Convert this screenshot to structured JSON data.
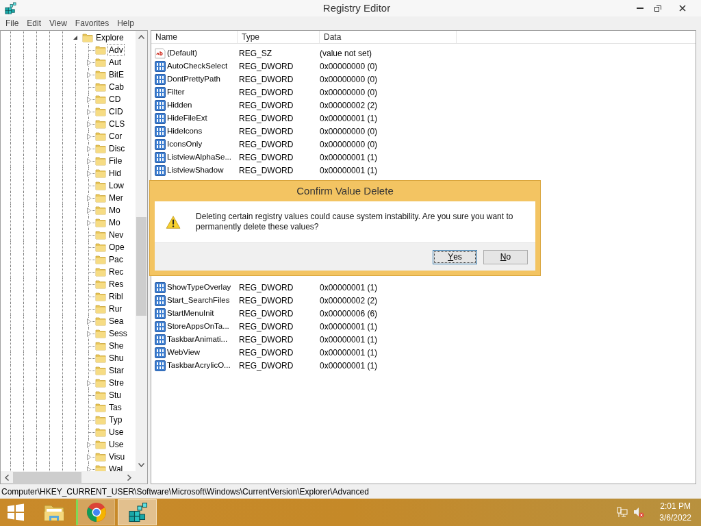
{
  "window": {
    "title": "Registry Editor"
  },
  "menu": [
    "File",
    "Edit",
    "View",
    "Favorites",
    "Help"
  ],
  "tree": [
    {
      "label": "Explore",
      "expanded": true,
      "selected": false,
      "children": [
        {
          "label": "Adv",
          "has_children": false,
          "selected": true
        },
        {
          "label": "Aut",
          "has_children": true,
          "selected": false
        },
        {
          "label": "BitE",
          "has_children": true,
          "selected": false
        },
        {
          "label": "Cab",
          "has_children": false,
          "selected": false
        },
        {
          "label": "CD",
          "has_children": true,
          "selected": false
        },
        {
          "label": "CID",
          "has_children": true,
          "selected": false
        },
        {
          "label": "CLS",
          "has_children": true,
          "selected": false
        },
        {
          "label": "Cor",
          "has_children": true,
          "selected": false
        },
        {
          "label": "Disc",
          "has_children": true,
          "selected": false
        },
        {
          "label": "File",
          "has_children": true,
          "selected": false
        },
        {
          "label": "Hid",
          "has_children": true,
          "selected": false
        },
        {
          "label": "Low",
          "has_children": false,
          "selected": false
        },
        {
          "label": "Mer",
          "has_children": true,
          "selected": false
        },
        {
          "label": "Mo",
          "has_children": true,
          "selected": false
        },
        {
          "label": "Mo",
          "has_children": true,
          "selected": false
        },
        {
          "label": "Nev",
          "has_children": false,
          "selected": false
        },
        {
          "label": "Ope",
          "has_children": false,
          "selected": false
        },
        {
          "label": "Pac",
          "has_children": false,
          "selected": false
        },
        {
          "label": "Rec",
          "has_children": false,
          "selected": false
        },
        {
          "label": "Res",
          "has_children": false,
          "selected": false
        },
        {
          "label": "Ribl",
          "has_children": false,
          "selected": false
        },
        {
          "label": "Rur",
          "has_children": false,
          "selected": false
        },
        {
          "label": "Sea",
          "has_children": true,
          "selected": false
        },
        {
          "label": "Sess",
          "has_children": true,
          "selected": false
        },
        {
          "label": "She",
          "has_children": false,
          "selected": false
        },
        {
          "label": "Shu",
          "has_children": false,
          "selected": false
        },
        {
          "label": "Star",
          "has_children": false,
          "selected": false
        },
        {
          "label": "Stre",
          "has_children": true,
          "selected": false
        },
        {
          "label": "Stu",
          "has_children": false,
          "selected": false
        },
        {
          "label": "Tas",
          "has_children": false,
          "selected": false
        },
        {
          "label": "Typ",
          "has_children": false,
          "selected": false
        },
        {
          "label": "Use",
          "has_children": false,
          "selected": false
        },
        {
          "label": "Use",
          "has_children": true,
          "selected": false
        },
        {
          "label": "Visu",
          "has_children": true,
          "selected": false
        },
        {
          "label": "Wal",
          "has_children": true,
          "selected": false
        }
      ]
    }
  ],
  "list": {
    "columns": [
      "Name",
      "Type",
      "Data"
    ],
    "rows_top": [
      {
        "kind": "string",
        "name": "(Default)",
        "type": "REG_SZ",
        "data": "(value not set)"
      },
      {
        "kind": "dword",
        "name": "AutoCheckSelect",
        "type": "REG_DWORD",
        "data": "0x00000000 (0)"
      },
      {
        "kind": "dword",
        "name": "DontPrettyPath",
        "type": "REG_DWORD",
        "data": "0x00000000 (0)"
      },
      {
        "kind": "dword",
        "name": "Filter",
        "type": "REG_DWORD",
        "data": "0x00000000 (0)"
      },
      {
        "kind": "dword",
        "name": "Hidden",
        "type": "REG_DWORD",
        "data": "0x00000002 (2)"
      },
      {
        "kind": "dword",
        "name": "HideFileExt",
        "type": "REG_DWORD",
        "data": "0x00000001 (1)"
      },
      {
        "kind": "dword",
        "name": "HideIcons",
        "type": "REG_DWORD",
        "data": "0x00000000 (0)"
      },
      {
        "kind": "dword",
        "name": "IconsOnly",
        "type": "REG_DWORD",
        "data": "0x00000000 (0)"
      },
      {
        "kind": "dword",
        "name": "ListviewAlphaSe...",
        "type": "REG_DWORD",
        "data": "0x00000001 (1)"
      },
      {
        "kind": "dword",
        "name": "ListviewShadow",
        "type": "REG_DWORD",
        "data": "0x00000001 (1)"
      }
    ],
    "rows_bottom": [
      {
        "kind": "dword",
        "name": "ShowTypeOverlay",
        "type": "REG_DWORD",
        "data": "0x00000001 (1)"
      },
      {
        "kind": "dword",
        "name": "Start_SearchFiles",
        "type": "REG_DWORD",
        "data": "0x00000002 (2)"
      },
      {
        "kind": "dword",
        "name": "StartMenuInit",
        "type": "REG_DWORD",
        "data": "0x00000006 (6)"
      },
      {
        "kind": "dword",
        "name": "StoreAppsOnTa...",
        "type": "REG_DWORD",
        "data": "0x00000001 (1)"
      },
      {
        "kind": "dword",
        "name": "TaskbarAnimati...",
        "type": "REG_DWORD",
        "data": "0x00000001 (1)"
      },
      {
        "kind": "dword",
        "name": "WebView",
        "type": "REG_DWORD",
        "data": "0x00000001 (1)"
      },
      {
        "kind": "dword",
        "name": "TaskbarAcrylicO...",
        "type": "REG_DWORD",
        "data": "0x00000001 (1)"
      }
    ]
  },
  "dialog": {
    "title": "Confirm Value Delete",
    "message": "Deleting certain registry values could cause system instability. Are you sure you want to permanently delete these values?",
    "buttons": [
      {
        "label": "Yes",
        "focused": true
      },
      {
        "label": "No",
        "focused": false
      }
    ]
  },
  "status_bar": {
    "path": "Computer\\HKEY_CURRENT_USER\\Software\\Microsoft\\Windows\\CurrentVersion\\Explorer\\Advanced"
  },
  "taskbar": {
    "apps": [
      {
        "kind": "start",
        "running": false,
        "selected": false
      },
      {
        "kind": "folder",
        "running": false,
        "selected": false
      },
      {
        "kind": "browser",
        "running": true,
        "selected": false
      },
      {
        "kind": "registry",
        "running": true,
        "selected": true
      }
    ],
    "time": "2:01 PM",
    "date": "3/6/2022"
  }
}
